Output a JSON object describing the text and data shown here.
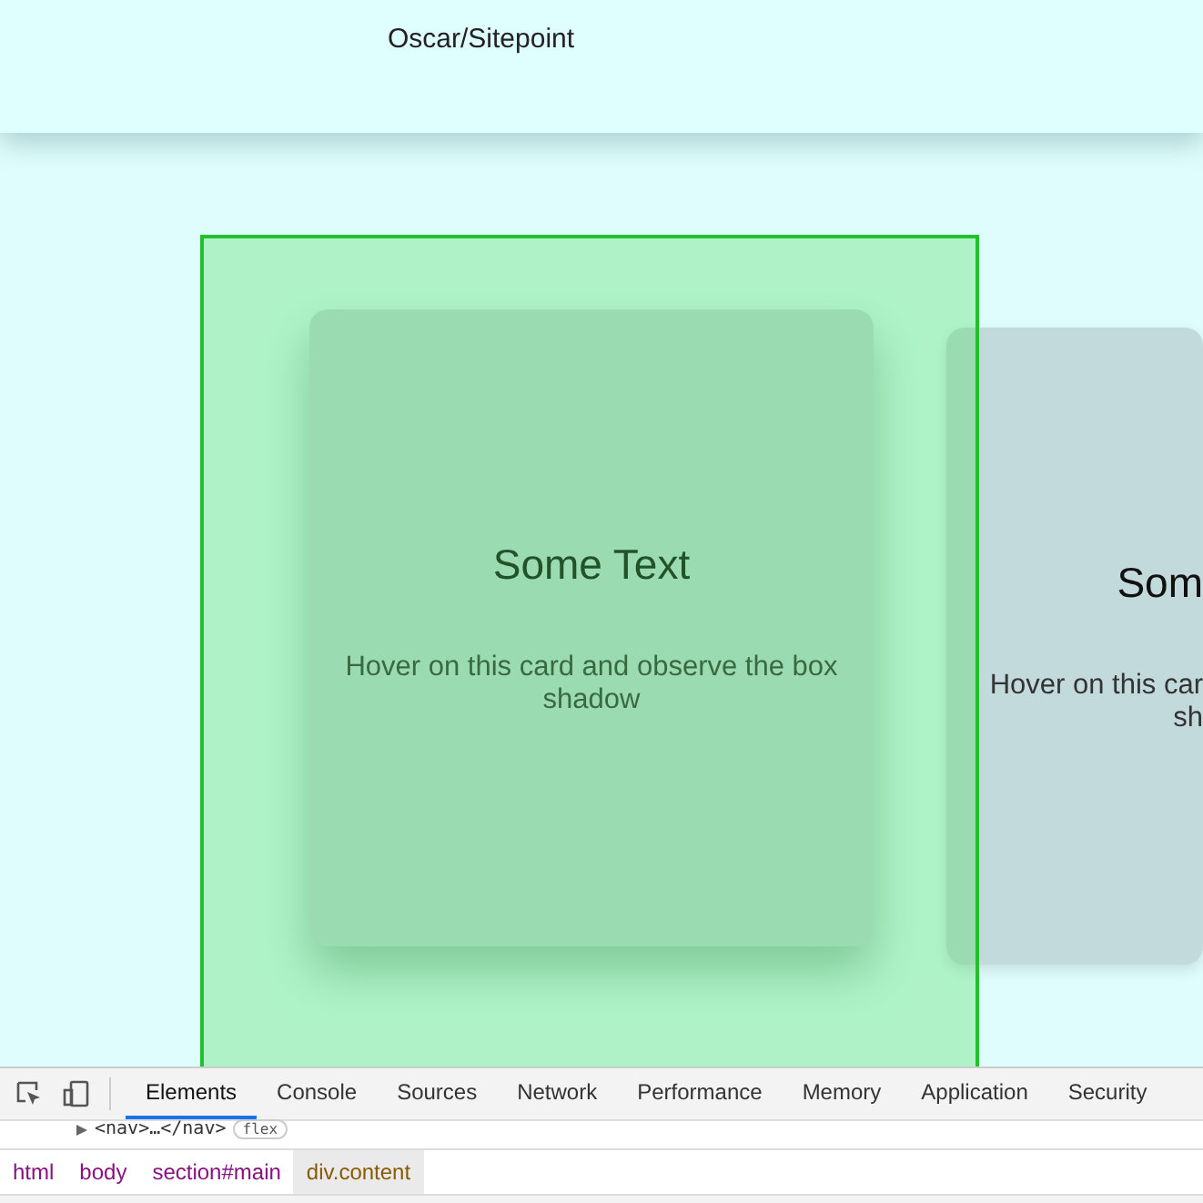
{
  "header": {
    "title": "Oscar/Sitepoint"
  },
  "cards": [
    {
      "title": "Some Text",
      "description_lines": [
        "Hover on this card and observe the box",
        "shadow"
      ],
      "hovered": true,
      "cut": false
    },
    {
      "title": "Som",
      "description_lines": [
        "Hover on this car",
        "sh"
      ],
      "hovered": false,
      "cut": true
    }
  ],
  "highlight": {
    "visible": true
  },
  "devtools": {
    "tabs": [
      {
        "label": "Elements",
        "selected": true
      },
      {
        "label": "Console",
        "selected": false
      },
      {
        "label": "Sources",
        "selected": false
      },
      {
        "label": "Network",
        "selected": false
      },
      {
        "label": "Performance",
        "selected": false
      },
      {
        "label": "Memory",
        "selected": false
      },
      {
        "label": "Application",
        "selected": false
      },
      {
        "label": "Security",
        "selected": false
      }
    ],
    "dom_line": {
      "code": "<nav>…</nav>",
      "badge": "flex"
    },
    "breadcrumbs": [
      {
        "label": "html",
        "selected": false
      },
      {
        "label": "body",
        "selected": false
      },
      {
        "label": "section#main",
        "selected": false
      },
      {
        "label": "div.content",
        "selected": true
      }
    ]
  }
}
